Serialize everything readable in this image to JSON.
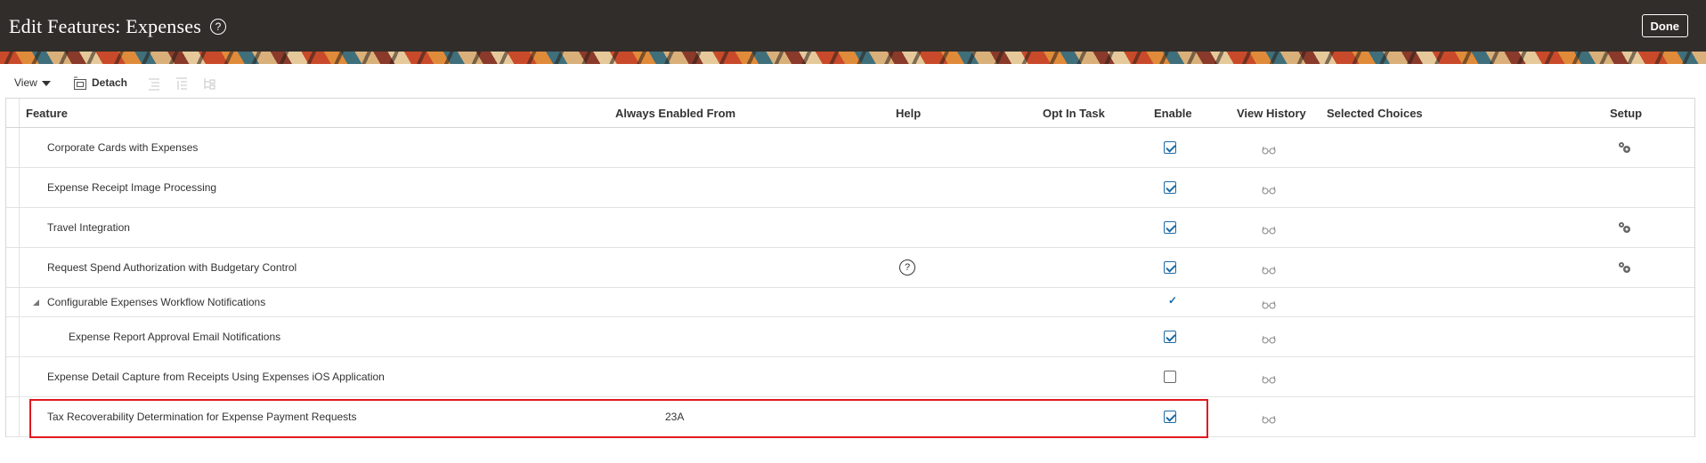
{
  "header": {
    "title": "Edit Features: Expenses",
    "help_glyph": "?",
    "done_label": "Done"
  },
  "toolbar": {
    "view_label": "View",
    "detach_label": "Detach"
  },
  "table": {
    "columns": {
      "feature": "Feature",
      "always_enabled_from": "Always Enabled From",
      "help": "Help",
      "opt_in_task": "Opt In Task",
      "enable": "Enable",
      "view_history": "View History",
      "selected_choices": "Selected Choices",
      "setup": "Setup"
    },
    "rows": [
      {
        "feature": "Corporate Cards with Expenses",
        "always_enabled_from": "",
        "help": false,
        "enable": "checked",
        "setup": true,
        "indent": 0
      },
      {
        "feature": "Expense Receipt Image Processing",
        "always_enabled_from": "",
        "help": false,
        "enable": "checked",
        "setup": false,
        "indent": 0
      },
      {
        "feature": "Travel Integration",
        "always_enabled_from": "",
        "help": false,
        "enable": "checked",
        "setup": true,
        "indent": 0
      },
      {
        "feature": "Request Spend Authorization with Budgetary Control",
        "always_enabled_from": "",
        "help": true,
        "enable": "checked",
        "setup": true,
        "indent": 0
      },
      {
        "feature": "Configurable Expenses Workflow Notifications",
        "always_enabled_from": "",
        "help": false,
        "enable": "tick",
        "setup": false,
        "indent": 0,
        "expanded": true
      },
      {
        "feature": "Expense Report Approval Email Notifications",
        "always_enabled_from": "",
        "help": false,
        "enable": "checked",
        "setup": false,
        "indent": 1
      },
      {
        "feature": "Expense Detail Capture from Receipts Using Expenses iOS Application",
        "always_enabled_from": "",
        "help": false,
        "enable": "unchecked",
        "setup": false,
        "indent": 0
      },
      {
        "feature": "Tax Recoverability Determination for Expense Payment Requests",
        "always_enabled_from": "23A",
        "help": false,
        "enable": "checked",
        "setup": false,
        "indent": 0,
        "highlighted": true
      }
    ]
  },
  "colors": {
    "header_bg": "#312d2a",
    "checkbox_accent": "#1c6aa6",
    "highlight_border": "#e0191f"
  },
  "icons": {
    "help": "question-circle-icon",
    "view_history": "glasses-icon",
    "setup": "gear-icon",
    "detach": "detach-icon",
    "expand": "triangle-expanded-icon"
  }
}
